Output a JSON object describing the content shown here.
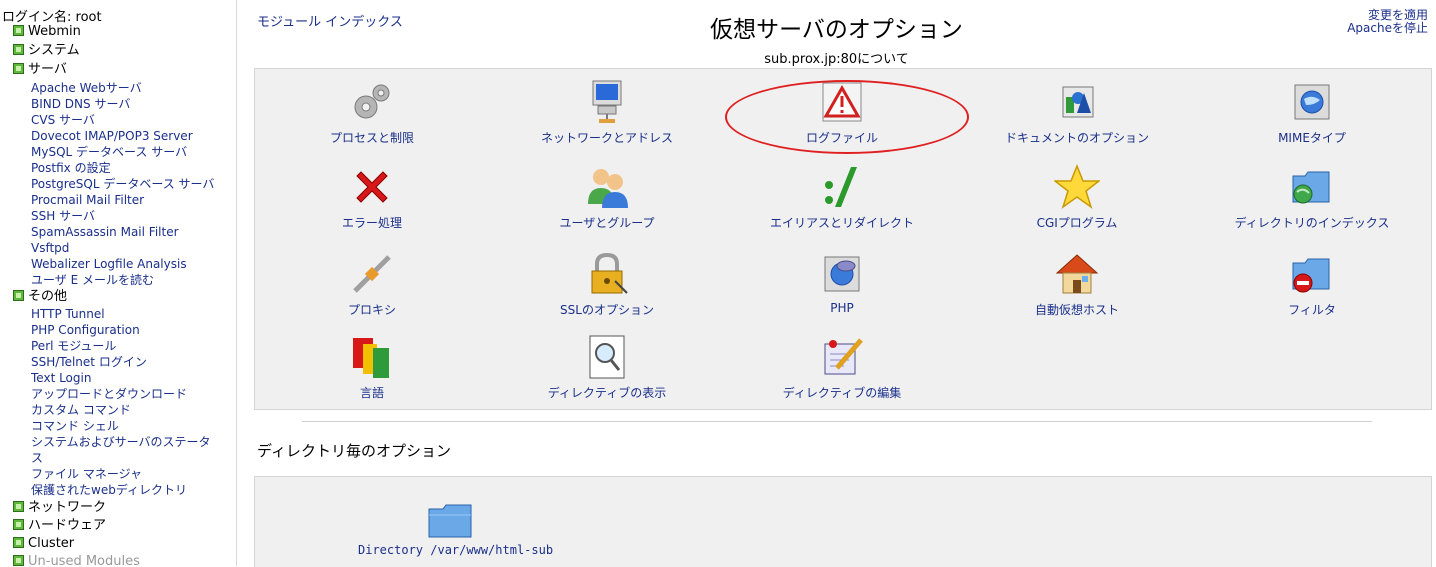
{
  "sidebar": {
    "login": "ログイン名: root",
    "categories": {
      "webmin": "Webmin",
      "system": "システム",
      "servers": "サーバ",
      "others": "その他",
      "network": "ネットワーク",
      "hardware": "ハードウェア",
      "cluster": "Cluster",
      "unused": "Un-used Modules"
    },
    "server_modules": [
      "Apache Webサーバ",
      "BIND DNS サーバ",
      "CVS サーバ",
      "Dovecot IMAP/POP3 Server",
      "MySQL データベース サーバ",
      "Postfix の設定",
      "PostgreSQL データベース サーバ",
      "Procmail Mail Filter",
      "SSH サーバ",
      "SpamAssassin Mail Filter",
      "Vsftpd",
      "Webalizer Logfile Analysis",
      "ユーザ E メールを読む"
    ],
    "other_modules": [
      "HTTP Tunnel",
      "PHP Configuration",
      "Perl モジュール",
      "SSH/Telnet ログイン",
      "Text Login",
      "アップロードとダウンロード",
      "カスタム コマンド",
      "コマンド シェル",
      "システムおよびサーバのステータ",
      "ス",
      "ファイル マネージャ",
      "保護されたwebディレクトリ"
    ]
  },
  "header": {
    "module_index": "モジュール インデックス",
    "title": "仮想サーバのオプション",
    "subtitle": "sub.prox.jp:80について",
    "apply_changes": "変更を適用",
    "stop_apache": "Apacheを停止"
  },
  "options": [
    {
      "label": "プロセスと制限",
      "icon": "gears-icon"
    },
    {
      "label": "ネットワークとアドレス",
      "icon": "network-computer-icon"
    },
    {
      "label": "ログファイル",
      "icon": "warning-triangle-icon"
    },
    {
      "label": "ドキュメントのオプション",
      "icon": "shapes-icon"
    },
    {
      "label": "MIMEタイプ",
      "icon": "mime-globe-icon"
    },
    {
      "label": "エラー処理",
      "icon": "red-x-icon"
    },
    {
      "label": "ユーザとグループ",
      "icon": "users-icon"
    },
    {
      "label": "エイリアスとリダイレクト",
      "icon": "colon-slash-icon"
    },
    {
      "label": "CGIプログラム",
      "icon": "star-icon"
    },
    {
      "label": "ディレクトリのインデックス",
      "icon": "folder-globe-icon"
    },
    {
      "label": "プロキシ",
      "icon": "proxy-icon"
    },
    {
      "label": "SSLのオプション",
      "icon": "padlock-icon"
    },
    {
      "label": "PHP",
      "icon": "php-icon"
    },
    {
      "label": "自動仮想ホスト",
      "icon": "house-icon"
    },
    {
      "label": "フィルタ",
      "icon": "folder-no-entry-icon"
    },
    {
      "label": "言語",
      "icon": "flags-icon"
    },
    {
      "label": "ディレクティブの表示",
      "icon": "magnifier-icon"
    },
    {
      "label": "ディレクティブの編集",
      "icon": "edit-pencil-icon"
    }
  ],
  "directory_section": {
    "heading": "ディレクトリ毎のオプション",
    "directory_label": "Directory /var/www/html-sub"
  }
}
